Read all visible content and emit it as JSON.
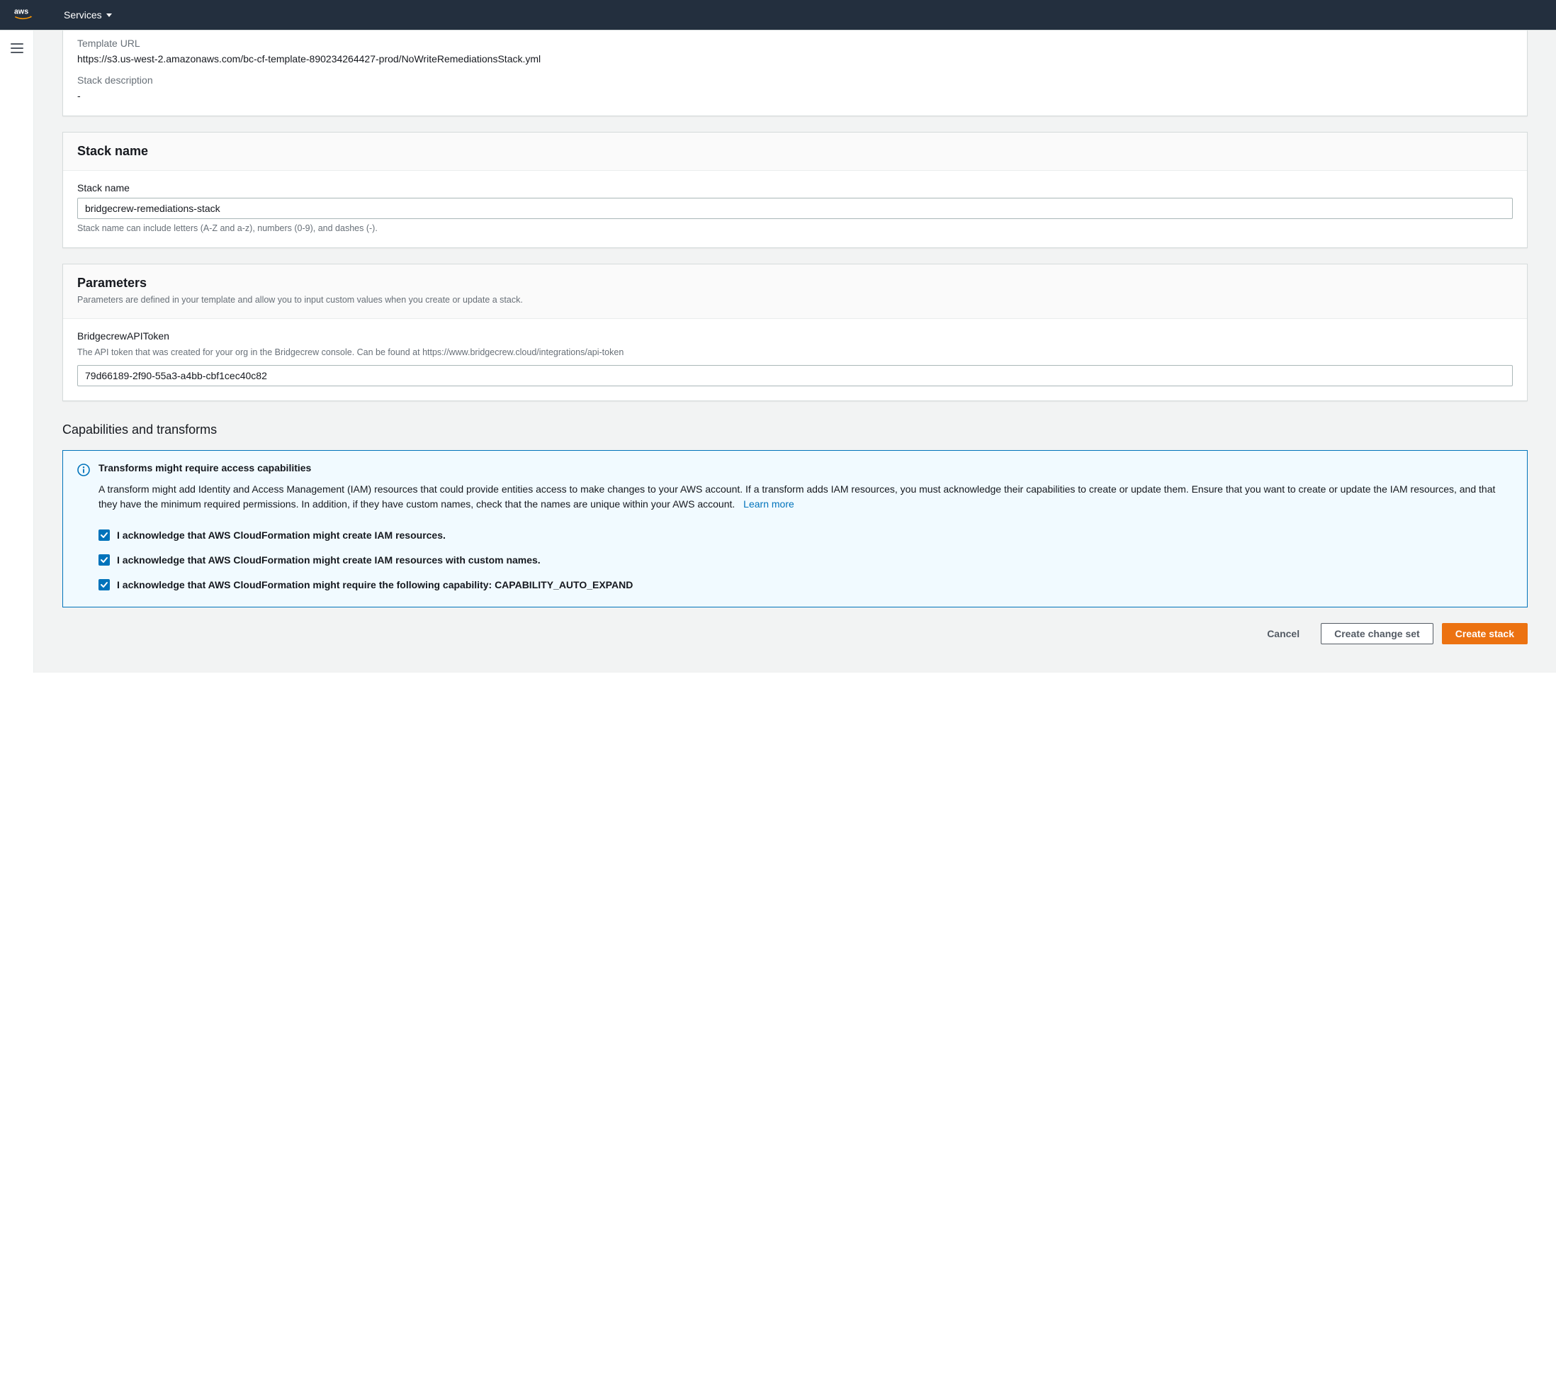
{
  "nav": {
    "services_label": "Services"
  },
  "template": {
    "url_label": "Template URL",
    "url_value": "https://s3.us-west-2.amazonaws.com/bc-cf-template-890234264427-prod/NoWriteRemediationsStack.yml",
    "desc_label": "Stack description",
    "desc_value": "-"
  },
  "stack": {
    "heading": "Stack name",
    "field_label": "Stack name",
    "value": "bridgecrew-remediations-stack",
    "helper": "Stack name can include letters (A-Z and a-z), numbers (0-9), and dashes (-)."
  },
  "params": {
    "heading": "Parameters",
    "subdesc": "Parameters are defined in your template and allow you to input custom values when you create or update a stack.",
    "token_label": "BridgecrewAPIToken",
    "token_desc": "The API token that was created for your org in the Bridgecrew console. Can be found at https://www.bridgecrew.cloud/integrations/api-token",
    "token_value": "79d66189-2f90-55a3-a4bb-cbf1cec40c82"
  },
  "caps": {
    "heading": "Capabilities and transforms",
    "info_title": "Transforms might require access capabilities",
    "info_text": "A transform might add Identity and Access Management (IAM) resources that could provide entities access to make changes to your AWS account. If a transform adds IAM resources, you must acknowledge their capabilities to create or update them. Ensure that you want to create or update the IAM resources, and that they have the minimum required permissions. In addition, if they have custom names, check that the names are unique within your AWS account.",
    "learn_more": "Learn more",
    "ack1": "I acknowledge that AWS CloudFormation might create IAM resources.",
    "ack2": "I acknowledge that AWS CloudFormation might create IAM resources with custom names.",
    "ack3": "I acknowledge that AWS CloudFormation might require the following capability: CAPABILITY_AUTO_EXPAND"
  },
  "buttons": {
    "cancel": "Cancel",
    "changeset": "Create change set",
    "create": "Create stack"
  }
}
